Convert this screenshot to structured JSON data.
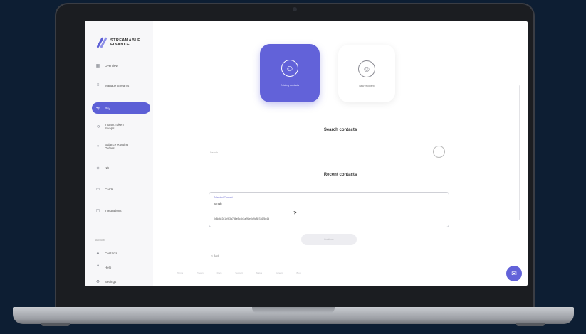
{
  "app": {
    "brand": "STREAMABLE FINANCE"
  },
  "sidebar": {
    "items": [
      {
        "label": "Overview",
        "icon": "grid-icon"
      },
      {
        "label": "Manage Streams",
        "icon": "list-icon"
      },
      {
        "label": "Pay",
        "icon": "transfer-icon",
        "active": true
      },
      {
        "label": "Instant Token Swaps",
        "icon": "swap-icon"
      },
      {
        "label": "Balance Routing Orders",
        "icon": "route-icon"
      },
      {
        "label": "Nft",
        "icon": "diamond-icon"
      },
      {
        "label": "Cards",
        "icon": "card-icon"
      },
      {
        "label": "Integrations",
        "icon": "plug-icon"
      }
    ],
    "section_label": "Account",
    "account_items": [
      {
        "label": "Contacts",
        "icon": "user-icon"
      },
      {
        "label": "Help",
        "icon": "help-icon"
      },
      {
        "label": "Settings",
        "icon": "settings-icon"
      }
    ]
  },
  "main": {
    "tiles": [
      {
        "caption": "Existing contacts",
        "icon": "user-circle-icon"
      },
      {
        "caption": "New recipient",
        "icon": "user-add-icon"
      }
    ],
    "search_heading": "Search contacts",
    "search_placeholder": "Search...",
    "recent_heading": "Recent contacts",
    "recent_card": {
      "label": "Selected Contact",
      "name": "Smith",
      "address": "0x8d4e2c1b9f3a7d6e5c4b3a2f1e0d9c8b7a6f5e4d"
    },
    "continue_label": "Continue",
    "back_label": "< Back",
    "footer_text": "Terms Privacy Docs Support Status Careers Blog"
  },
  "colors": {
    "accent": "#6262d9",
    "background": "#0d1e33"
  }
}
